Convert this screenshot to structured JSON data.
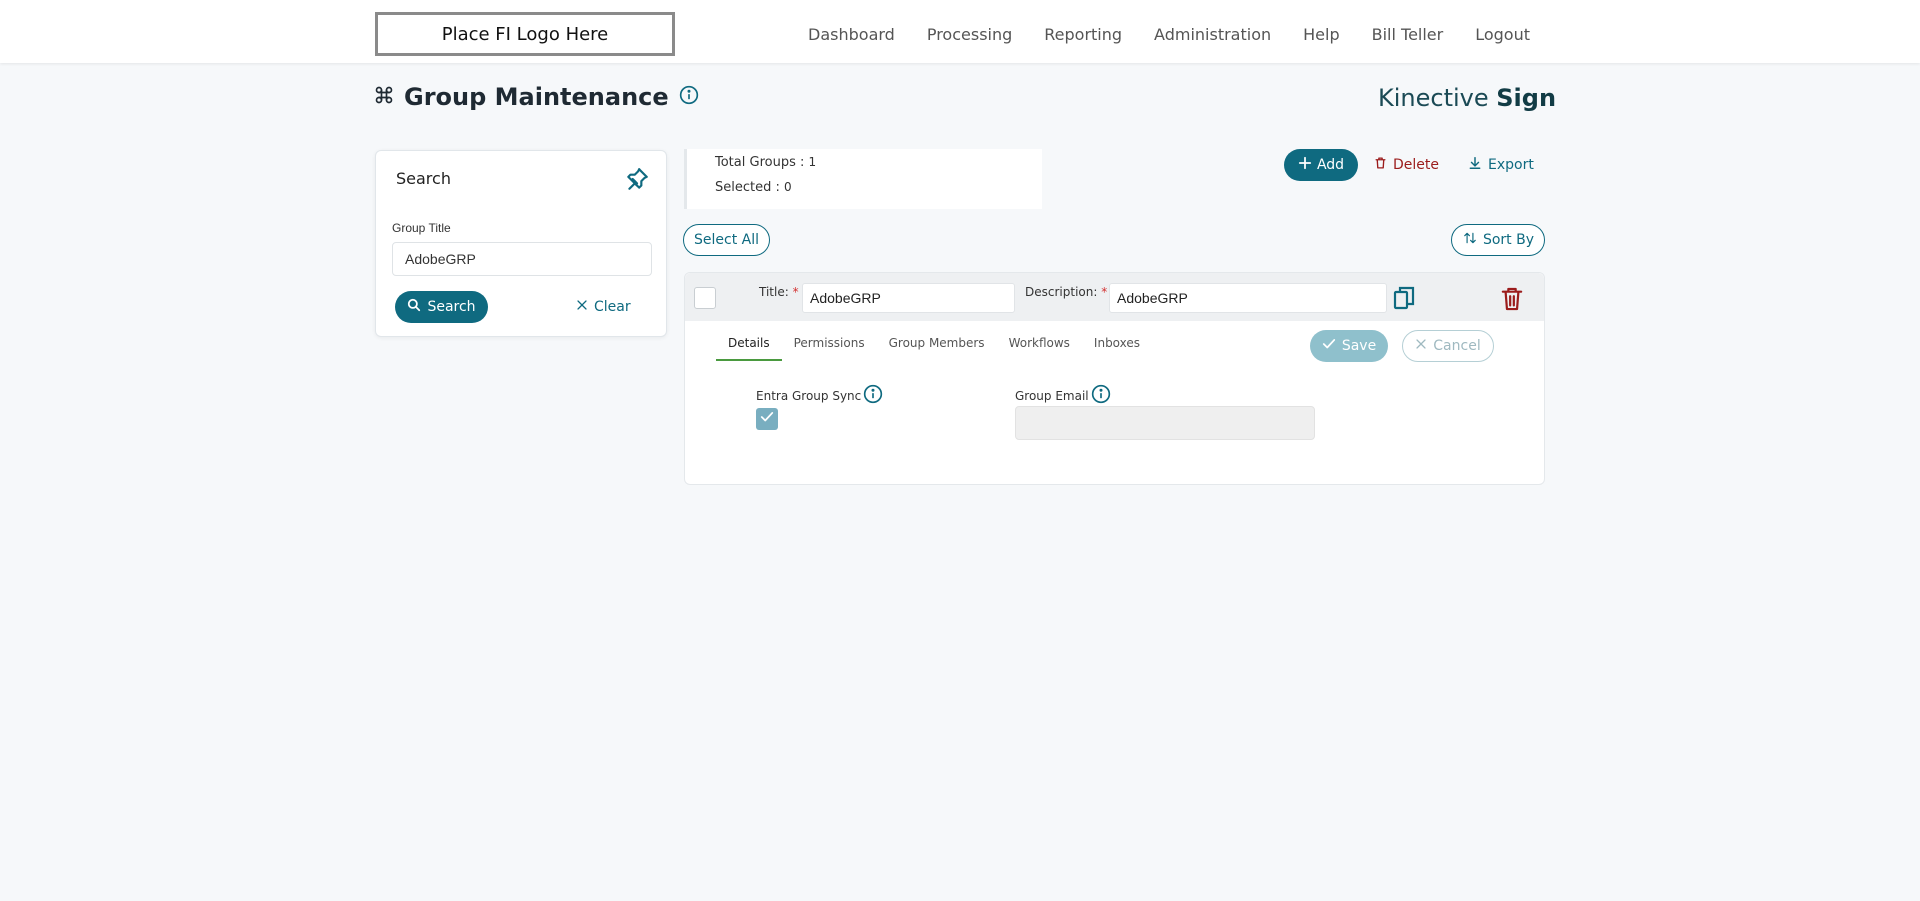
{
  "header": {
    "logo_text": "Place FI Logo Here",
    "nav": [
      "Dashboard",
      "Processing",
      "Reporting",
      "Administration",
      "Help",
      "Bill Teller",
      "Logout"
    ]
  },
  "page": {
    "title": "Group Maintenance",
    "brand_regular": "Kinective",
    "brand_bold": "Sign"
  },
  "search": {
    "title": "Search",
    "field_label": "Group Title",
    "field_value": "AdobeGRP",
    "search_label": "Search",
    "clear_label": "Clear"
  },
  "stats": {
    "total_label": "Total Groups :",
    "total_value": "1",
    "selected_label": "Selected :",
    "selected_value": "0"
  },
  "toolbar": {
    "add_label": "Add",
    "delete_label": "Delete",
    "export_label": "Export",
    "select_all_label": "Select All",
    "sort_by_label": "Sort By"
  },
  "group": {
    "title_label": "Title:",
    "title_value": "AdobeGRP",
    "description_label": "Description:",
    "description_value": "AdobeGRP",
    "required_mark": "*",
    "tabs": [
      "Details",
      "Permissions",
      "Group Members",
      "Workflows",
      "Inboxes"
    ],
    "save_label": "Save",
    "cancel_label": "Cancel",
    "entra_sync_label": "Entra Group Sync",
    "entra_sync_checked": true,
    "group_email_label": "Group Email",
    "group_email_value": ""
  },
  "colors": {
    "primary": "#0f6a80",
    "danger": "#9b1c1c",
    "tab_active": "#4a9a3f",
    "save_disabled": "#8fc0cc"
  }
}
